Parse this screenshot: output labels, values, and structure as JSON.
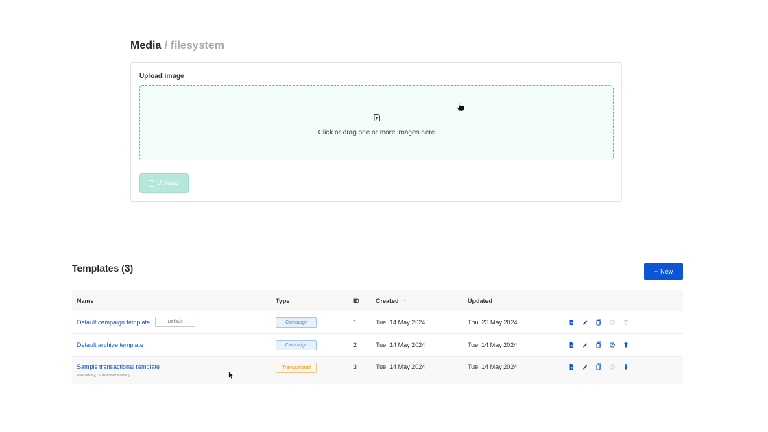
{
  "media": {
    "title": "Media",
    "separator": "/",
    "subtitle": "filesystem",
    "upload_label": "Upload image",
    "drop_text": "Click or drag one or more images here",
    "upload_button": "Upload",
    "accent_color": "#3fc4b0"
  },
  "templates": {
    "title": "Templates (3)",
    "new_button": "New",
    "new_button_icon": "+",
    "columns": {
      "name": "Name",
      "type": "Type",
      "id": "ID",
      "created": "Created",
      "created_sort": "↑",
      "updated": "Updated"
    },
    "rows": [
      {
        "name": "Default campaign template",
        "default_tag": "Default",
        "type": "Campaign",
        "id": "1",
        "created": "Tue, 14 May 2024",
        "updated": "Thu, 23 May 2024"
      },
      {
        "name": "Default archive template",
        "type": "Campaign",
        "id": "2",
        "created": "Tue, 14 May 2024",
        "updated": "Tue, 14 May 2024"
      },
      {
        "name": "Sample transactional template",
        "subject": "Welcome {{ .Subscriber.Name }}",
        "type": "Transactional",
        "id": "3",
        "created": "Tue, 14 May 2024",
        "updated": "Tue, 14 May 2024"
      }
    ],
    "action_icons": [
      "preview-icon",
      "edit-icon",
      "clone-icon",
      "set-default-icon",
      "delete-icon"
    ],
    "primary_color": "#0c55d6"
  }
}
